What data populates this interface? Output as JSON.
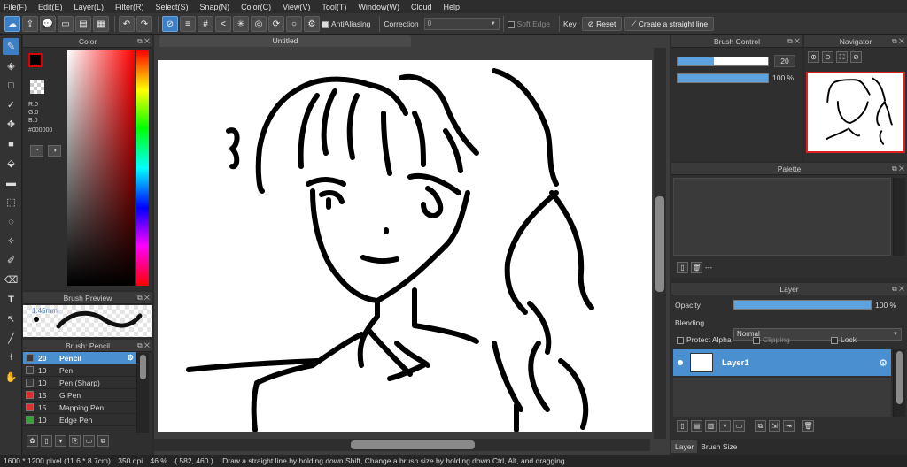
{
  "menu": [
    "File(F)",
    "Edit(E)",
    "Layer(L)",
    "Filter(R)",
    "Select(S)",
    "Snap(N)",
    "Color(C)",
    "View(V)",
    "Tool(T)",
    "Window(W)",
    "Cloud",
    "Help"
  ],
  "toolbar": {
    "antialiasing": "AntiAliasing",
    "correction_label": "Correction",
    "correction_value": "0",
    "soft_edge": "Soft Edge",
    "key": "Key",
    "reset": "Reset",
    "straight_line": "Create a straight line"
  },
  "color_panel": {
    "title": "Color",
    "r": "R:0",
    "g": "G:0",
    "b": "B:0",
    "hex": "#000000"
  },
  "brush_preview": {
    "title": "Brush Preview",
    "size": "1.45mm"
  },
  "brush_list": {
    "title": "Brush: Pencil",
    "items": [
      {
        "size": "20",
        "name": "Pencil",
        "color": "#3a3a3a"
      },
      {
        "size": "10",
        "name": "Pen",
        "color": "#3a3a3a"
      },
      {
        "size": "10",
        "name": "Pen (Sharp)",
        "color": "#3a3a3a"
      },
      {
        "size": "15",
        "name": "G Pen",
        "color": "#d83030"
      },
      {
        "size": "15",
        "name": "Mapping Pen",
        "color": "#d83030"
      },
      {
        "size": "10",
        "name": "Edge Pen",
        "color": "#3aa03a"
      }
    ]
  },
  "canvas": {
    "tab_title": "Untitled"
  },
  "brush_control": {
    "title": "Brush Control",
    "size_value": "20",
    "opacity_value": "100 %",
    "size_fraction": 0.4,
    "opacity_fraction": 1.0
  },
  "navigator": {
    "title": "Navigator"
  },
  "palette": {
    "title": "Palette",
    "footer": "---"
  },
  "layer_panel": {
    "title": "Layer",
    "opacity_label": "Opacity",
    "opacity_value": "100 %",
    "blending_label": "Blending",
    "blending_value": "Normal",
    "protect_alpha": "Protect Alpha",
    "clipping": "Clipping",
    "lock": "Lock",
    "layers": [
      {
        "name": "Layer1"
      }
    ]
  },
  "bottom_tabs": [
    "Layer",
    "Brush Size"
  ],
  "status": {
    "size": "1600 * 1200 pixel",
    "physical": "(11.6 * 8.7cm)",
    "dpi": "350 dpi",
    "zoom": "46 %",
    "coords": "( 582, 460 )",
    "hint": "Draw a straight line by holding down Shift, Change a brush size by holding down Ctrl, Alt, and dragging"
  },
  "colors": {
    "accent": "#3d7fc4",
    "selected_row": "#4a90d1",
    "primary_color": "#000000",
    "nav_frame": "#e02020"
  }
}
